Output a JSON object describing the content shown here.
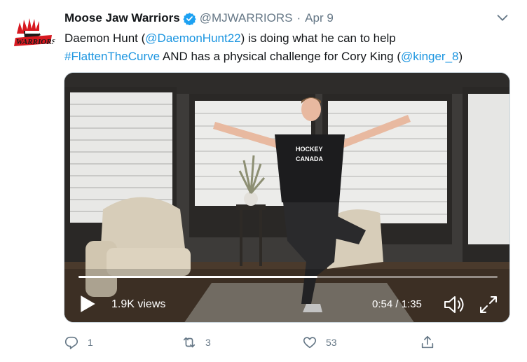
{
  "tweet": {
    "display_name": "Moose Jaw Warriors",
    "handle": "@MJWARRIORS",
    "separator": "·",
    "date": "Apr 9",
    "text_parts": {
      "p1": "Daemon Hunt (",
      "mention1": "@DaemonHunt22",
      "p2": ") is doing what he can to help",
      "hashtag": "#FlattenTheCurve",
      "p3": " AND has a physical challenge for Cory King (",
      "mention2": "@kinger_8",
      "p4": ")"
    },
    "avatar_logo_text": "WARRIORS"
  },
  "video": {
    "views": "1.9K views",
    "time": "0:54 / 1:35",
    "progress": 0.57,
    "shirt_text_line1": "HOCKEY",
    "shirt_text_line2": "CANADA"
  },
  "actions": {
    "reply_count": "1",
    "retweet_count": "3",
    "like_count": "53"
  },
  "colors": {
    "link": "#1b95e0",
    "verified": "#1da1f2",
    "secondary_text": "#657786",
    "primary_text": "#14171a",
    "logo_red": "#d71920"
  },
  "icons": [
    "verified-badge-icon",
    "chevron-down-icon",
    "play-icon",
    "volume-icon",
    "expand-icon",
    "reply-icon",
    "retweet-icon",
    "like-icon",
    "share-icon"
  ]
}
